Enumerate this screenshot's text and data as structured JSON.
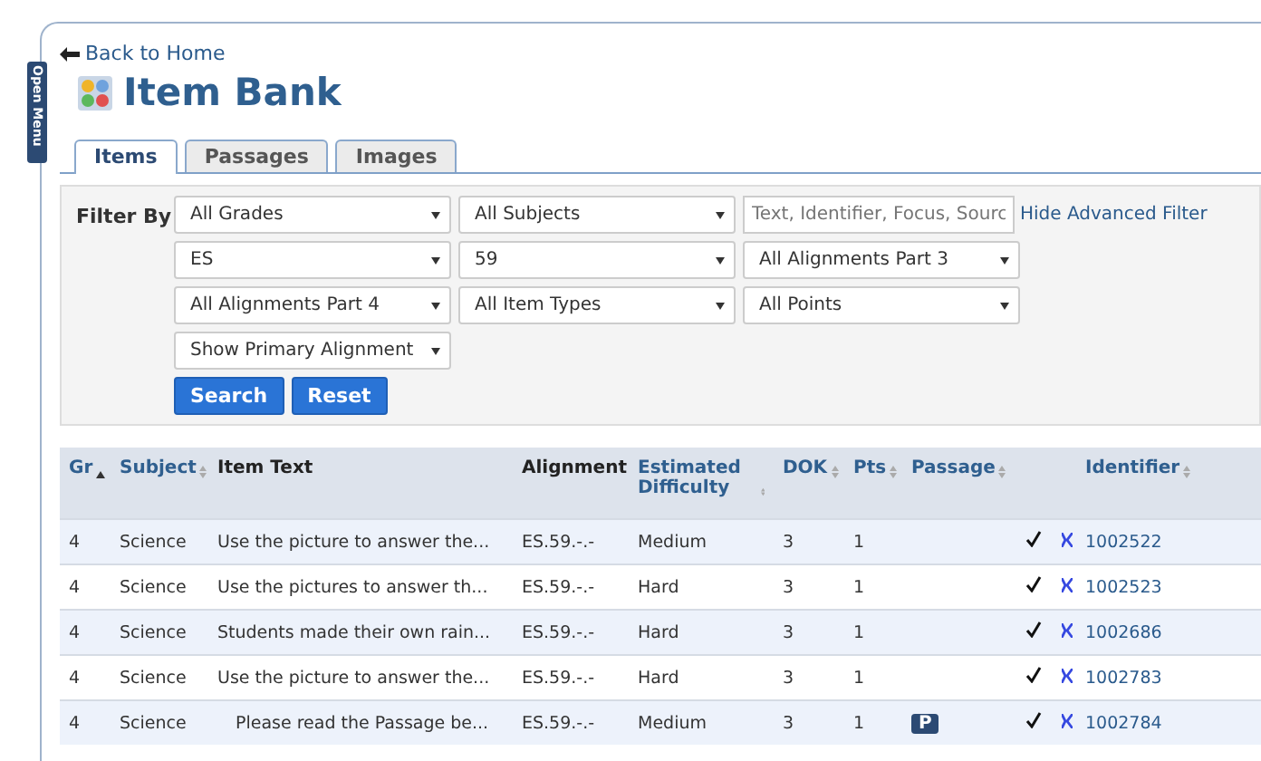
{
  "side_tab": {
    "label": "Open Menu"
  },
  "back_link": "Back to Home",
  "title": "Item Bank",
  "tabs": [
    {
      "label": "Items",
      "selected": true
    },
    {
      "label": "Passages",
      "selected": false
    },
    {
      "label": "Images",
      "selected": false
    }
  ],
  "filter": {
    "label": "Filter By",
    "rows": [
      [
        {
          "kind": "select",
          "value": "All Grades"
        },
        {
          "kind": "select",
          "value": "All Subjects"
        },
        {
          "kind": "text",
          "placeholder": "Text, Identifier, Focus, Sourc"
        },
        {
          "kind": "link",
          "label": "Hide Advanced Filter"
        }
      ],
      [
        {
          "kind": "select",
          "value": "ES"
        },
        {
          "kind": "select",
          "value": "59"
        },
        {
          "kind": "select",
          "value": "All Alignments Part 3"
        }
      ],
      [
        {
          "kind": "select",
          "value": "All Alignments Part 4"
        },
        {
          "kind": "select",
          "value": "All Item Types"
        },
        {
          "kind": "select",
          "value": "All Points"
        }
      ],
      [
        {
          "kind": "select",
          "value": "Show Primary Alignment"
        }
      ]
    ],
    "buttons": [
      "Search",
      "Reset"
    ]
  },
  "table": {
    "columns": [
      {
        "label": "Gr",
        "sortable": true,
        "sorted": true
      },
      {
        "label": "Subject",
        "sortable": true,
        "sorted": false
      },
      {
        "label": "Item Text",
        "sortable": false
      },
      {
        "label": "Alignment",
        "sortable": false
      },
      {
        "label": "Estimated Difficulty",
        "sortable": true,
        "sorted": false
      },
      {
        "label": "DOK",
        "sortable": true,
        "sorted": false
      },
      {
        "label": "Pts",
        "sortable": true,
        "sorted": false
      },
      {
        "label": "Passage",
        "sortable": true,
        "sorted": false
      },
      {
        "label": "Identifier",
        "sortable": true,
        "sorted": false
      }
    ],
    "rows": [
      {
        "gr": "4",
        "subject": "Science",
        "item_text": "Use the picture to answer the...",
        "indented": false,
        "alignment": "ES.59.-.-",
        "difficulty": "Medium",
        "dok": "3",
        "pts": "1",
        "checked": true,
        "identifier": "1002522"
      },
      {
        "gr": "4",
        "subject": "Science",
        "item_text": "Use the pictures to answer th...",
        "indented": false,
        "alignment": "ES.59.-.-",
        "difficulty": "Hard",
        "dok": "3",
        "pts": "1",
        "checked": true,
        "identifier": "1002523"
      },
      {
        "gr": "4",
        "subject": "Science",
        "item_text": "Students made their own rain...",
        "indented": false,
        "alignment": "ES.59.-.-",
        "difficulty": "Hard",
        "dok": "3",
        "pts": "1",
        "checked": true,
        "identifier": "1002686"
      },
      {
        "gr": "4",
        "subject": "Science",
        "item_text": "Use the picture to answer the...",
        "indented": false,
        "alignment": "ES.59.-.-",
        "difficulty": "Hard",
        "dok": "3",
        "pts": "1",
        "checked": true,
        "identifier": "1002783"
      },
      {
        "gr": "4",
        "subject": "Science",
        "item_text": "Please read the Passage be...",
        "indented": true,
        "alignment": "ES.59.-.-",
        "difficulty": "Medium",
        "dok": "3",
        "pts": "1",
        "passage": "P",
        "checked": true,
        "identifier": "1002784"
      }
    ]
  }
}
